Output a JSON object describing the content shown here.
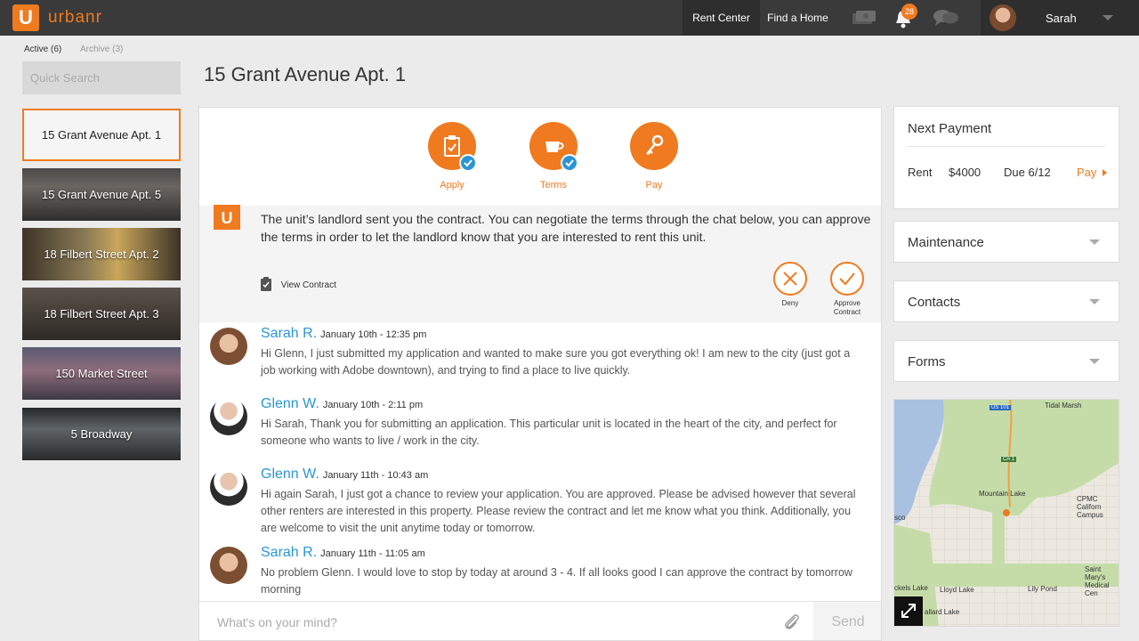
{
  "topbar": {
    "logo_letter": "U",
    "brand": "urbanr",
    "nav": [
      "Rent Center",
      "Find a Home"
    ],
    "notification_count": "28",
    "user_name": "Sarah",
    "icons": [
      "money-icon",
      "bell-icon",
      "chat-icon",
      "avatar",
      "chevron-down-icon"
    ]
  },
  "sidebar": {
    "tabs": {
      "active": "Active (6)",
      "archive": "Archive (3)"
    },
    "search_placeholder": "Quick Search",
    "listings": [
      "15 Grant Avenue Apt. 1",
      "15 Grant Avenue Apt. 5",
      "18 Filbert Street Apt. 2",
      "18 Filbert Street Apt. 3",
      "150 Market Street",
      "5 Broadway"
    ]
  },
  "page": {
    "title": "15 Grant Avenue Apt. 1"
  },
  "steps": [
    {
      "label": "Apply",
      "done": true,
      "icon": "clipboard-icon"
    },
    {
      "label": "Terms",
      "done": true,
      "icon": "coffee-cup-icon"
    },
    {
      "label": "Pay",
      "done": false,
      "icon": "keys-icon"
    }
  ],
  "notice": {
    "logo_letter": "U",
    "text": "The unit’s landlord sent you the contract. You can negotiate the terms through the chat below, you can approve the terms in order to let the landlord know that you are interested to rent this unit.",
    "view_contract": "View Contract",
    "deny": "Deny",
    "approve_line1": "Approve",
    "approve_line2": "Contract"
  },
  "messages": [
    {
      "name": "Sarah R.",
      "time": "January 10th - 12:35 pm",
      "text": "Hi Glenn, I just submitted my application and wanted to make sure you got everything ok! I am new to the city (just got a job working with Adobe downtown), and trying to find a place to live quickly."
    },
    {
      "name": "Glenn W.",
      "time": "January 10th - 2:11 pm",
      "text": "Hi Sarah, Thank you for submitting an application. This particular unit is located in the heart of the city, and perfect for someone who wants to live / work in the city."
    },
    {
      "name": "Glenn W.",
      "time": "January 11th - 10:43 am",
      "text": "Hi again Sarah, I just got a chance to review your application. You are approved. Please be advised however that several other renters are interested in this property. Please review the contract and let me know what you think. Additionally, you are welcome to visit the unit anytime today or tomorrow."
    },
    {
      "name": "Sarah R.",
      "time": "January 11th - 11:05 am",
      "text": "No problem Glenn. I would love to stop by today at around 3 - 4. If all looks good I can approve the contract by tomorrow morning"
    }
  ],
  "compose": {
    "placeholder": "What's on your mind?",
    "send": "Send"
  },
  "payment": {
    "title": "Next Payment",
    "rent_label": "Rent",
    "amount": "$4000",
    "due": "Due 6/12",
    "pay": "Pay"
  },
  "cards": [
    "Maintenance",
    "Contacts",
    "Forms"
  ],
  "map": {
    "labels": [
      "Tidal Marsh",
      "US 101",
      "CA 1",
      "Mountain Lake",
      "CPMC Californ Campus",
      "sco",
      "Saint Mary's Medical Cen",
      "ckels Lake",
      "Lloyd Lake",
      "Lily Pond",
      "allard Lake"
    ]
  },
  "colors": {
    "accent": "#f07a1f",
    "link_blue": "#2a95d6",
    "topbar": "#3a3a3a"
  }
}
